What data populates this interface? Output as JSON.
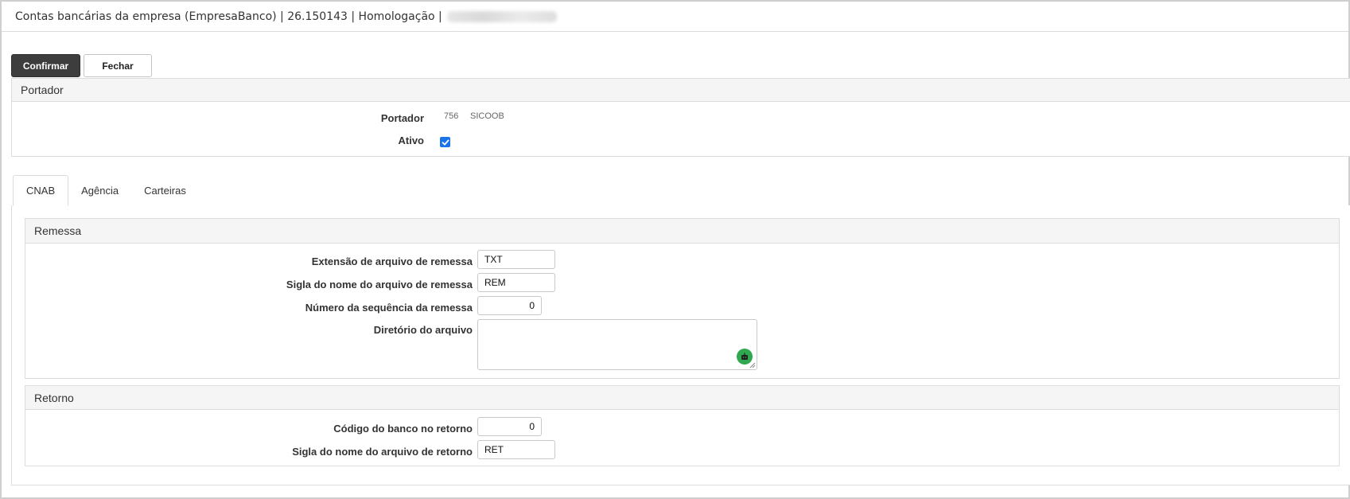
{
  "window": {
    "title": "Contas bancárias da empresa (EmpresaBanco) | 26.150143 | Homologação |"
  },
  "toolbar": {
    "confirm_label": "Confirmar",
    "close_label": "Fechar"
  },
  "portador_panel": {
    "header": "Portador",
    "portador_label": "Portador",
    "portador_code": "756",
    "portador_name": "SICOOB",
    "ativo_label": "Ativo",
    "ativo_checked": true
  },
  "tabs": [
    {
      "label": "CNAB",
      "active": true
    },
    {
      "label": "Agência",
      "active": false
    },
    {
      "label": "Carteiras",
      "active": false
    }
  ],
  "remessa": {
    "header": "Remessa",
    "extensao_label": "Extensão de arquivo de remessa",
    "extensao_value": "TXT",
    "sigla_label": "Sigla do nome do arquivo de remessa",
    "sigla_value": "REM",
    "sequencia_label": "Número da sequência da remessa",
    "sequencia_value": "0",
    "diretorio_label": "Diretório do arquivo",
    "diretorio_value": ""
  },
  "retorno": {
    "header": "Retorno",
    "codigo_label": "Código do banco no retorno",
    "codigo_value": "0",
    "sigla_label": "Sigla do nome do arquivo de retorno",
    "sigla_value": "RET"
  },
  "colors": {
    "primary_button": "#3d3d3d",
    "checkbox": "#1a73e8",
    "assistant_icon": "#2fa84f"
  }
}
